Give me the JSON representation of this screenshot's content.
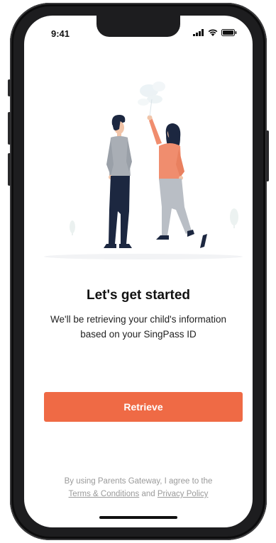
{
  "status_bar": {
    "time": "9:41",
    "icons": [
      "signal-icon",
      "wifi-icon",
      "battery-icon"
    ]
  },
  "onboarding": {
    "illustration": "two-people-illustration",
    "title": "Let's get started",
    "subtitle_line1": "We'll be retrieving your child's information",
    "subtitle_line2": "based on your SingPass ID",
    "retrieve_label": "Retrieve"
  },
  "terms": {
    "prefix": "By using Parents Gateway, I agree to the",
    "terms_link": "Terms & Conditions",
    "and": "and",
    "privacy_link": "Privacy Policy"
  },
  "colors": {
    "accent": "#ef6a45",
    "man_shirt": "#a9aeb5",
    "man_pants": "#1c2740",
    "woman_top": "#f08d6e",
    "woman_pants": "#b9bec5",
    "hair": "#1c2740"
  }
}
